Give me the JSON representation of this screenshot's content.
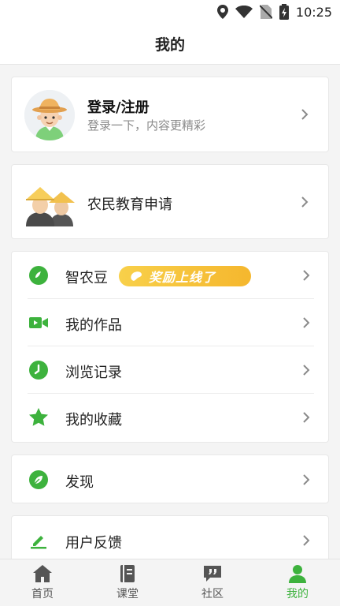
{
  "status_bar": {
    "time": "10:25"
  },
  "header": {
    "title": "我的"
  },
  "profile": {
    "title": "登录/注册",
    "subtitle": "登录一下，内容更精彩"
  },
  "education": {
    "label": "农民教育申请"
  },
  "menu_group": {
    "items": [
      {
        "label": "智农豆",
        "icon": "bean-icon",
        "badge": "奖励上线了"
      },
      {
        "label": "我的作品",
        "icon": "video-icon"
      },
      {
        "label": "浏览记录",
        "icon": "clock-icon"
      },
      {
        "label": "我的收藏",
        "icon": "star-icon"
      }
    ]
  },
  "discover": {
    "label": "发现",
    "icon": "leaf-icon"
  },
  "feedback": {
    "label": "用户反馈",
    "icon": "pencil-icon"
  },
  "bottom_nav": {
    "items": [
      {
        "label": "首页",
        "icon": "home-icon"
      },
      {
        "label": "课堂",
        "icon": "book-icon"
      },
      {
        "label": "社区",
        "icon": "quote-chat-icon"
      },
      {
        "label": "我的",
        "icon": "person-icon",
        "active": true
      }
    ]
  },
  "colors": {
    "accent": "#3db23d",
    "badge": "#f5c23a",
    "chevron": "#8a8a8a"
  }
}
